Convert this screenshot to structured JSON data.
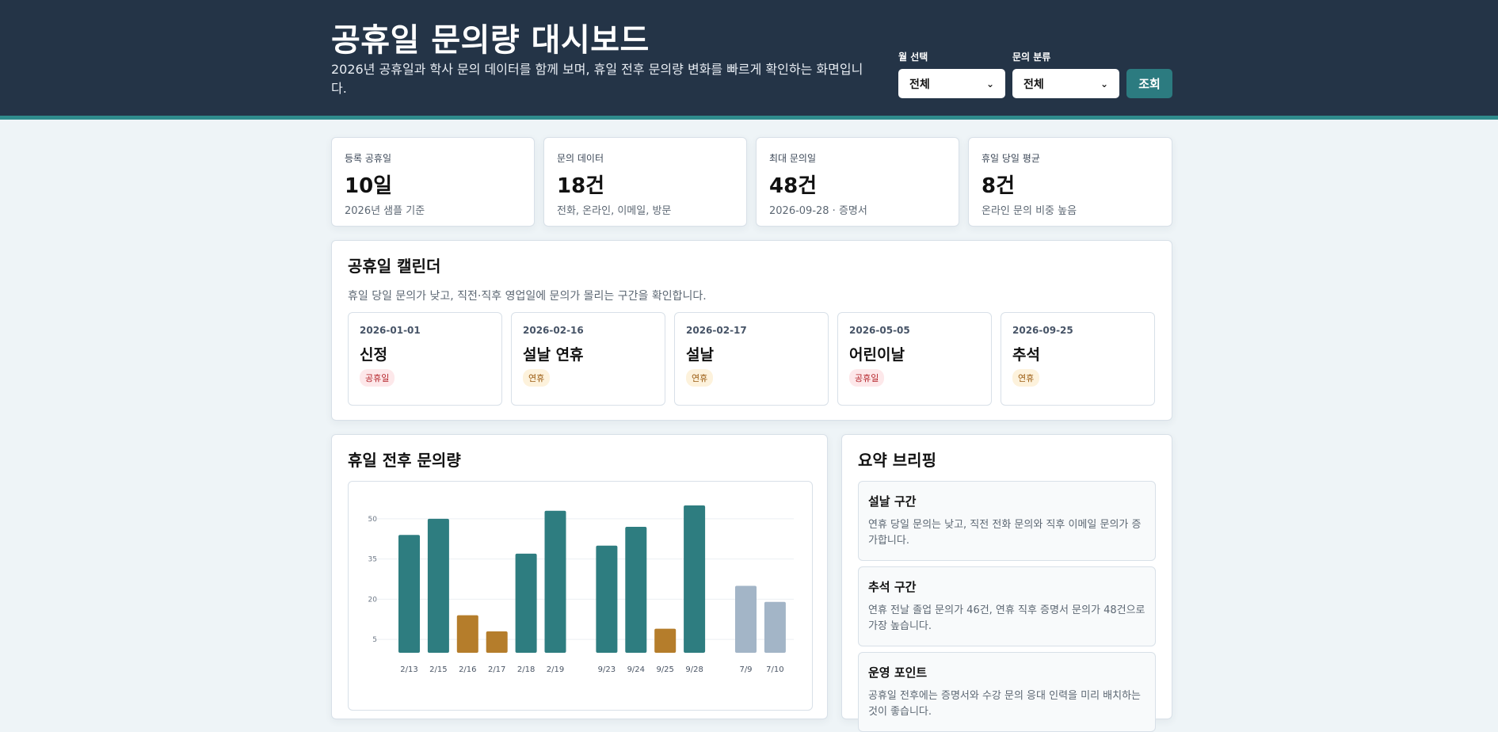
{
  "header": {
    "title": "공휴일 문의량 대시보드",
    "subtitle": "2026년 공휴일과 학사 문의 데이터를 함께 보며, 휴일 전후 문의량 변화를 빠르게 확인하는 화면입니다.",
    "month_label": "월 선택",
    "month_value": "전체",
    "category_label": "문의 분류",
    "category_value": "전체",
    "query_button": "조회"
  },
  "stats": [
    {
      "label": "등록 공휴일",
      "value": "10일",
      "sub": "2026년 샘플 기준"
    },
    {
      "label": "문의 데이터",
      "value": "18건",
      "sub": "전화, 온라인, 이메일, 방문"
    },
    {
      "label": "최대 문의일",
      "value": "48건",
      "sub": "2026-09-28 · 증명서"
    },
    {
      "label": "휴일 당일 평균",
      "value": "8건",
      "sub": "온라인 문의 비중 높음"
    }
  ],
  "calendar": {
    "title": "공휴일 캘린더",
    "desc": "휴일 당일 문의가 낮고, 직전·직후 영업일에 문의가 몰리는 구간을 확인합니다.",
    "days": [
      {
        "date": "2026-01-01",
        "name": "신정",
        "badge": "공휴일",
        "type": "holiday"
      },
      {
        "date": "2026-02-16",
        "name": "설날 연휴",
        "badge": "연휴",
        "type": "long"
      },
      {
        "date": "2026-02-17",
        "name": "설날",
        "badge": "연휴",
        "type": "long"
      },
      {
        "date": "2026-05-05",
        "name": "어린이날",
        "badge": "공휴일",
        "type": "holiday"
      },
      {
        "date": "2026-09-25",
        "name": "추석",
        "badge": "연휴",
        "type": "long"
      }
    ]
  },
  "chart_section": {
    "title": "휴일 전후 문의량"
  },
  "chart_data": {
    "type": "bar",
    "categories": [
      "2/13",
      "2/15",
      "2/16",
      "2/17",
      "2/18",
      "2/19",
      "9/23",
      "9/24",
      "9/25",
      "9/28",
      "7/9",
      "7/10"
    ],
    "values": [
      44,
      50,
      14,
      8,
      37,
      53,
      40,
      47,
      9,
      55,
      25,
      19
    ],
    "groups": [
      0,
      0,
      0,
      0,
      0,
      0,
      1,
      1,
      1,
      1,
      2,
      2
    ],
    "bar_types": [
      "normal",
      "normal",
      "holiday",
      "holiday",
      "normal",
      "normal",
      "normal",
      "normal",
      "holiday",
      "normal",
      "other",
      "other"
    ],
    "colors": {
      "normal": "#2e7d80",
      "holiday": "#b57d2b",
      "other": "#a3b5c7"
    },
    "yticks": [
      5,
      20,
      35,
      50
    ],
    "ylim": [
      0,
      55
    ],
    "grid": true
  },
  "brief_section": {
    "title": "요약 브리핑",
    "items": [
      {
        "title": "설날 구간",
        "desc": "연휴 당일 문의는 낮고, 직전 전화 문의와 직후 이메일 문의가 증가합니다."
      },
      {
        "title": "추석 구간",
        "desc": "연휴 전날 졸업 문의가 46건, 연휴 직후 증명서 문의가 48건으로 가장 높습니다."
      },
      {
        "title": "운영 포인트",
        "desc": "공휴일 전후에는 증명서와 수강 문의 응대 인력을 미리 배치하는 것이 좋습니다."
      }
    ]
  }
}
